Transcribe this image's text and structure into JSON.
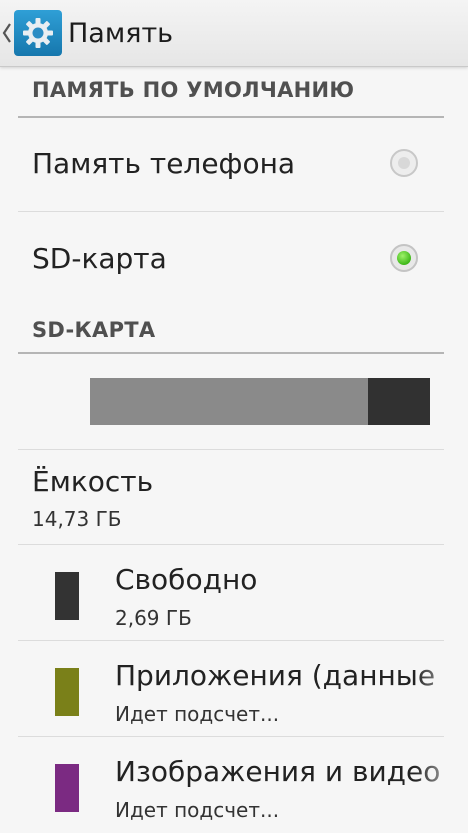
{
  "action_bar": {
    "title": "Память"
  },
  "sections": {
    "default_storage_header": "ПАМЯТЬ ПО УМОЛЧАНИЮ",
    "sd_card_header": "SD-КАРТА"
  },
  "storage_options": [
    {
      "label": "Память телефона",
      "selected": false
    },
    {
      "label": "SD-карта",
      "selected": true
    }
  ],
  "usage": {
    "used_fraction": 0.817,
    "used_color": "#8a8a8a",
    "free_color": "#313131"
  },
  "capacity": {
    "title": "Ёмкость",
    "value": "14,73 ГБ"
  },
  "categories": [
    {
      "title": "Свободно",
      "value": "2,69 ГБ",
      "color": "#333333"
    },
    {
      "title": "Приложения (данные",
      "value": "Идет подсчет...",
      "color": "#7a8019"
    },
    {
      "title": "Изображения и видео",
      "value": "Идет подсчет...",
      "color": "#7b2a82"
    }
  ],
  "icons": {
    "back": "chevron-left-icon",
    "app": "gear-icon"
  }
}
